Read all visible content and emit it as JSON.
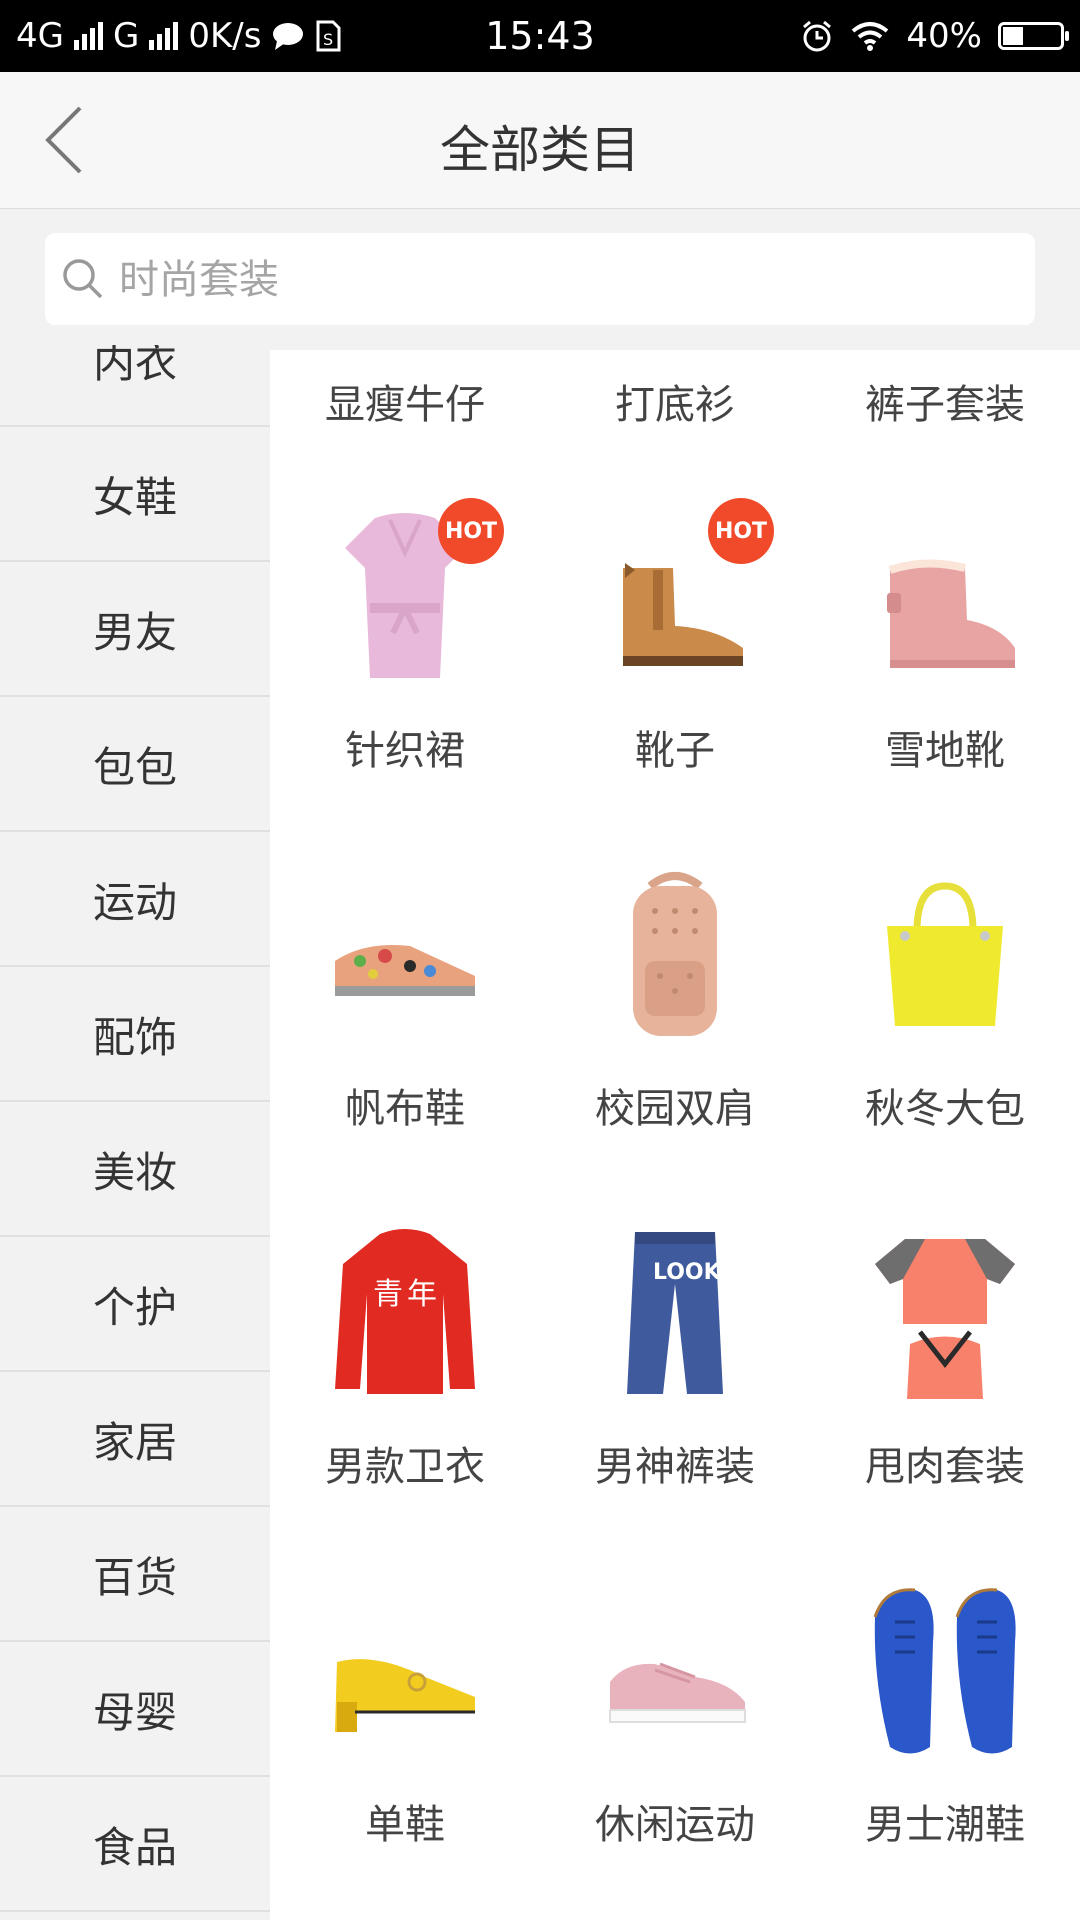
{
  "status_bar": {
    "network_left": "4G",
    "network_right": "G",
    "speed": "0K/s",
    "time": "15:43",
    "battery": "40%",
    "battery_level": 0.4
  },
  "header": {
    "title": "全部类目"
  },
  "search": {
    "placeholder": "时尚套装"
  },
  "sidebar": {
    "items": [
      "内衣",
      "女鞋",
      "男友",
      "包包",
      "运动",
      "配饰",
      "美妆",
      "个护",
      "家居",
      "百货",
      "母婴",
      "食品"
    ]
  },
  "content": {
    "top_links": [
      "显瘦牛仔",
      "打底衫",
      "裤子套装"
    ],
    "hot_label": "HOT",
    "grid": [
      {
        "label": "针织裙",
        "hot": true,
        "icon": "pink-knit-dress-image"
      },
      {
        "label": "靴子",
        "hot": true,
        "icon": "ankle-boot-image"
      },
      {
        "label": "雪地靴",
        "hot": false,
        "icon": "snow-boot-image"
      },
      {
        "label": "帆布鞋",
        "hot": false,
        "icon": "canvas-shoe-image"
      },
      {
        "label": "校园双肩",
        "hot": false,
        "icon": "backpack-image"
      },
      {
        "label": "秋冬大包",
        "hot": false,
        "icon": "yellow-handbag-image"
      },
      {
        "label": "男款卫衣",
        "hot": false,
        "icon": "red-hoodie-image"
      },
      {
        "label": "男神裤装",
        "hot": false,
        "icon": "jeans-image"
      },
      {
        "label": "甩肉套装",
        "hot": false,
        "icon": "sport-set-image"
      },
      {
        "label": "单鞋",
        "hot": false,
        "icon": "yellow-loafer-image"
      },
      {
        "label": "休闲运动",
        "hot": false,
        "icon": "pink-sneaker-image"
      },
      {
        "label": "男士潮鞋",
        "hot": false,
        "icon": "blue-sneakers-image"
      }
    ]
  }
}
